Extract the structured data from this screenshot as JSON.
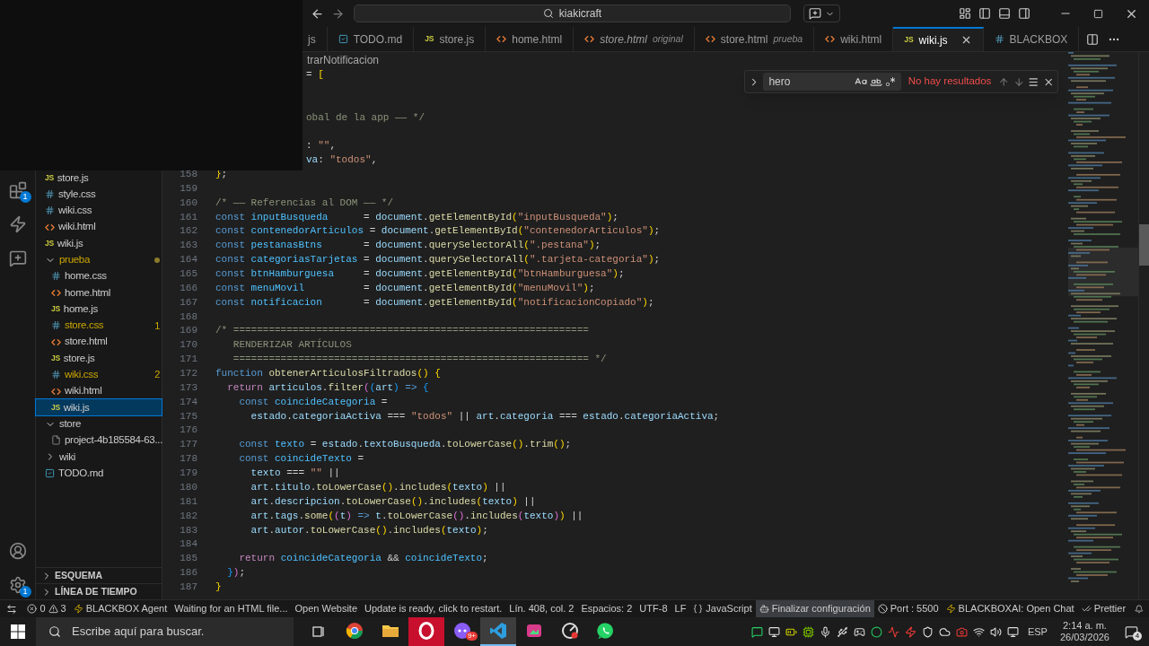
{
  "title_bar": {
    "search": "kiakicraft"
  },
  "activity_bar": {
    "extensions_badge": "1",
    "settings_badge": "1"
  },
  "tabs": [
    {
      "label": "js",
      "kind": "none",
      "italic": false,
      "selected": false
    },
    {
      "label": "TODO.md",
      "kind": "md",
      "italic": false,
      "selected": false
    },
    {
      "label": "store.js",
      "kind": "js",
      "icon_label": "JS",
      "italic": false,
      "selected": false
    },
    {
      "label": "home.html",
      "kind": "html",
      "italic": false,
      "selected": false
    },
    {
      "label": "store.html",
      "description": "original",
      "kind": "html",
      "italic": true,
      "selected": false
    },
    {
      "label": "store.html",
      "description": "prueba",
      "kind": "html",
      "italic": false,
      "selected": false
    },
    {
      "label": "wiki.html",
      "kind": "html",
      "italic": false,
      "selected": false
    },
    {
      "label": "wiki.js",
      "kind": "js",
      "icon_label": "JS",
      "italic": false,
      "selected": true
    },
    {
      "label": "BLACKBOX",
      "kind": "css",
      "italic": false,
      "selected": false
    }
  ],
  "explorer": {
    "items": [
      {
        "kind": "group",
        "children": [
          {
            "name": "store.js",
            "kind": "js",
            "icon_label": "JS",
            "selected": false,
            "warning": false
          },
          {
            "name": "style.css",
            "kind": "css",
            "selected": false,
            "warning": false
          },
          {
            "name": "wiki.css",
            "kind": "css",
            "selected": false,
            "warning": false
          },
          {
            "name": "wiki.html",
            "kind": "html",
            "selected": false,
            "warning": false
          },
          {
            "name": "wiki.js",
            "kind": "js",
            "icon_label": "JS",
            "selected": false,
            "warning": false
          }
        ]
      },
      {
        "name": "prueba",
        "kind": "folder",
        "expanded": true,
        "selected": false,
        "warning": true,
        "modified": true,
        "children": [
          {
            "name": "home.css",
            "kind": "css",
            "selected": false,
            "warning": false
          },
          {
            "name": "home.html",
            "kind": "html",
            "selected": false,
            "warning": false
          },
          {
            "name": "home.js",
            "kind": "js",
            "icon_label": "JS",
            "selected": false,
            "warning": false
          },
          {
            "name": "store.css",
            "kind": "css",
            "selected": false,
            "warning": true,
            "badge": "1"
          },
          {
            "name": "store.html",
            "kind": "html",
            "selected": false,
            "warning": false
          },
          {
            "name": "store.js",
            "kind": "js",
            "icon_label": "JS",
            "selected": false,
            "warning": false
          },
          {
            "name": "wiki.css",
            "kind": "css",
            "selected": false,
            "warning": true,
            "badge": "2"
          },
          {
            "name": "wiki.html",
            "kind": "html",
            "selected": false,
            "warning": false
          },
          {
            "name": "wiki.js",
            "kind": "js",
            "icon_label": "JS",
            "selected": true,
            "warning": false
          }
        ]
      },
      {
        "name": "store",
        "kind": "folder",
        "expanded": true,
        "selected": false,
        "warning": false,
        "modified": false,
        "children": [
          {
            "name": "project-4b185584-63...",
            "kind": "file",
            "selected": false,
            "warning": false
          }
        ]
      },
      {
        "name": "wiki",
        "kind": "folder",
        "expanded": false,
        "selected": false,
        "warning": false,
        "modified": false
      },
      {
        "name": "TODO.md",
        "kind": "md",
        "selected": false,
        "warning": false
      }
    ],
    "sections": [
      {
        "label": "ESQUEMA",
        "expanded": false
      },
      {
        "label": "LÍNEA DE TIEMPO",
        "expanded": false
      }
    ]
  },
  "editor": {
    "breadcrumb": "trarNotificacion",
    "find": {
      "value": "hero",
      "status": "No hay resultados"
    },
    "lines": [
      {
        "kind": "partial",
        "tokens": [
          {
            "kind": "plain",
            "text": "= "
          },
          {
            "kind": "bracket1",
            "text": "["
          }
        ]
      },
      {
        "kind": "partial"
      },
      {
        "kind": "partial"
      },
      {
        "kind": "partial",
        "tokens": [
          {
            "kind": "comment",
            "text": "obal de la app —— */"
          }
        ]
      },
      {
        "kind": "partial"
      },
      {
        "kind": "partial",
        "tokens": [
          {
            "kind": "plain",
            "text": ": "
          },
          {
            "kind": "string",
            "text": "\"\""
          },
          {
            "kind": "plain",
            "text": ","
          }
        ]
      },
      {
        "kind": "partial",
        "tokens": [
          {
            "kind": "variable",
            "text": "va"
          },
          {
            "kind": "plain",
            "text": ": "
          },
          {
            "kind": "string",
            "text": "\"todos\""
          },
          {
            "kind": "plain",
            "text": ","
          }
        ]
      },
      {
        "kind": "code",
        "number": "158",
        "tokens": [
          {
            "kind": "bracket1",
            "text": "}"
          },
          {
            "kind": "plain",
            "text": ";"
          }
        ]
      },
      {
        "kind": "code",
        "number": "159"
      },
      {
        "kind": "code",
        "number": "160",
        "tokens": [
          {
            "kind": "comment",
            "text": "/* —— Referencias al DOM —— */"
          }
        ]
      },
      {
        "kind": "code",
        "number": "161",
        "tokens": [
          {
            "kind": "keyword",
            "text": "const "
          },
          {
            "kind": "constant",
            "text": "inputBusqueda"
          },
          {
            "kind": "plain",
            "text": "      = "
          },
          {
            "kind": "variable",
            "text": "document"
          },
          {
            "kind": "plain",
            "text": "."
          },
          {
            "kind": "function",
            "text": "getElementById"
          },
          {
            "kind": "bracket1",
            "text": "("
          },
          {
            "kind": "string",
            "text": "\"inputBusqueda\""
          },
          {
            "kind": "bracket1",
            "text": ")"
          },
          {
            "kind": "plain",
            "text": ";"
          }
        ]
      },
      {
        "kind": "code",
        "number": "162",
        "tokens": [
          {
            "kind": "keyword",
            "text": "const "
          },
          {
            "kind": "constant",
            "text": "contenedorArticulos"
          },
          {
            "kind": "plain",
            "text": " = "
          },
          {
            "kind": "variable",
            "text": "document"
          },
          {
            "kind": "plain",
            "text": "."
          },
          {
            "kind": "function",
            "text": "getElementById"
          },
          {
            "kind": "bracket1",
            "text": "("
          },
          {
            "kind": "string",
            "text": "\"contenedorArticulos\""
          },
          {
            "kind": "bracket1",
            "text": ")"
          },
          {
            "kind": "plain",
            "text": ";"
          }
        ]
      },
      {
        "kind": "code",
        "number": "163",
        "tokens": [
          {
            "kind": "keyword",
            "text": "const "
          },
          {
            "kind": "constant",
            "text": "pestanasBtns"
          },
          {
            "kind": "plain",
            "text": "       = "
          },
          {
            "kind": "variable",
            "text": "document"
          },
          {
            "kind": "plain",
            "text": "."
          },
          {
            "kind": "function",
            "text": "querySelectorAll"
          },
          {
            "kind": "bracket1",
            "text": "("
          },
          {
            "kind": "string",
            "text": "\".pestana\""
          },
          {
            "kind": "bracket1",
            "text": ")"
          },
          {
            "kind": "plain",
            "text": ";"
          }
        ]
      },
      {
        "kind": "code",
        "number": "164",
        "tokens": [
          {
            "kind": "keyword",
            "text": "const "
          },
          {
            "kind": "constant",
            "text": "categoriasTarjetas"
          },
          {
            "kind": "plain",
            "text": " = "
          },
          {
            "kind": "variable",
            "text": "document"
          },
          {
            "kind": "plain",
            "text": "."
          },
          {
            "kind": "function",
            "text": "querySelectorAll"
          },
          {
            "kind": "bracket1",
            "text": "("
          },
          {
            "kind": "string",
            "text": "\".tarjeta-categoria\""
          },
          {
            "kind": "bracket1",
            "text": ")"
          },
          {
            "kind": "plain",
            "text": ";"
          }
        ]
      },
      {
        "kind": "code",
        "number": "165",
        "tokens": [
          {
            "kind": "keyword",
            "text": "const "
          },
          {
            "kind": "constant",
            "text": "btnHamburguesa"
          },
          {
            "kind": "plain",
            "text": "     = "
          },
          {
            "kind": "variable",
            "text": "document"
          },
          {
            "kind": "plain",
            "text": "."
          },
          {
            "kind": "function",
            "text": "getElementById"
          },
          {
            "kind": "bracket1",
            "text": "("
          },
          {
            "kind": "string",
            "text": "\"btnHamburguesa\""
          },
          {
            "kind": "bracket1",
            "text": ")"
          },
          {
            "kind": "plain",
            "text": ";"
          }
        ]
      },
      {
        "kind": "code",
        "number": "166",
        "tokens": [
          {
            "kind": "keyword",
            "text": "const "
          },
          {
            "kind": "constant",
            "text": "menuMovil"
          },
          {
            "kind": "plain",
            "text": "          = "
          },
          {
            "kind": "variable",
            "text": "document"
          },
          {
            "kind": "plain",
            "text": "."
          },
          {
            "kind": "function",
            "text": "getElementById"
          },
          {
            "kind": "bracket1",
            "text": "("
          },
          {
            "kind": "string",
            "text": "\"menuMovil\""
          },
          {
            "kind": "bracket1",
            "text": ")"
          },
          {
            "kind": "plain",
            "text": ";"
          }
        ]
      },
      {
        "kind": "code",
        "number": "167",
        "tokens": [
          {
            "kind": "keyword",
            "text": "const "
          },
          {
            "kind": "constant",
            "text": "notificacion"
          },
          {
            "kind": "plain",
            "text": "       = "
          },
          {
            "kind": "variable",
            "text": "document"
          },
          {
            "kind": "plain",
            "text": "."
          },
          {
            "kind": "function",
            "text": "getElementById"
          },
          {
            "kind": "bracket1",
            "text": "("
          },
          {
            "kind": "string",
            "text": "\"notificacionCopiado\""
          },
          {
            "kind": "bracket1",
            "text": ")"
          },
          {
            "kind": "plain",
            "text": ";"
          }
        ]
      },
      {
        "kind": "code",
        "number": "168"
      },
      {
        "kind": "code",
        "number": "169",
        "tokens": [
          {
            "kind": "comment",
            "text": "/* ============================================================"
          }
        ]
      },
      {
        "kind": "code",
        "number": "170",
        "tokens": [
          {
            "kind": "comment",
            "text": "   RENDERIZAR ARTÍCULOS"
          }
        ]
      },
      {
        "kind": "code",
        "number": "171",
        "tokens": [
          {
            "kind": "comment",
            "text": "   ============================================================ */"
          }
        ]
      },
      {
        "kind": "code",
        "number": "172",
        "tokens": [
          {
            "kind": "keyword",
            "text": "function "
          },
          {
            "kind": "function",
            "text": "obtenerArticulosFiltrados"
          },
          {
            "kind": "bracket1",
            "text": "() {"
          }
        ]
      },
      {
        "kind": "code",
        "number": "173",
        "tokens": [
          {
            "kind": "control",
            "text": "  return "
          },
          {
            "kind": "variable",
            "text": "articulos"
          },
          {
            "kind": "plain",
            "text": "."
          },
          {
            "kind": "function",
            "text": "filter"
          },
          {
            "kind": "bracket2",
            "text": "("
          },
          {
            "kind": "bracket3",
            "text": "("
          },
          {
            "kind": "variable",
            "text": "art"
          },
          {
            "kind": "bracket3",
            "text": ")"
          },
          {
            "kind": "keyword",
            "text": " => "
          },
          {
            "kind": "bracket3",
            "text": "{"
          }
        ]
      },
      {
        "kind": "code",
        "number": "174",
        "tokens": [
          {
            "kind": "keyword",
            "text": "    const "
          },
          {
            "kind": "constant",
            "text": "coincideCategoria"
          },
          {
            "kind": "plain",
            "text": " ="
          }
        ]
      },
      {
        "kind": "code",
        "number": "175",
        "tokens": [
          {
            "kind": "variable",
            "text": "      estado"
          },
          {
            "kind": "plain",
            "text": "."
          },
          {
            "kind": "variable",
            "text": "categoriaActiva"
          },
          {
            "kind": "plain",
            "text": " === "
          },
          {
            "kind": "string",
            "text": "\"todos\""
          },
          {
            "kind": "plain",
            "text": " || "
          },
          {
            "kind": "variable",
            "text": "art"
          },
          {
            "kind": "plain",
            "text": "."
          },
          {
            "kind": "variable",
            "text": "categoria"
          },
          {
            "kind": "plain",
            "text": " === "
          },
          {
            "kind": "variable",
            "text": "estado"
          },
          {
            "kind": "plain",
            "text": "."
          },
          {
            "kind": "variable",
            "text": "categoriaActiva"
          },
          {
            "kind": "plain",
            "text": ";"
          }
        ]
      },
      {
        "kind": "code",
        "number": "176"
      },
      {
        "kind": "code",
        "number": "177",
        "tokens": [
          {
            "kind": "keyword",
            "text": "    const "
          },
          {
            "kind": "constant",
            "text": "texto"
          },
          {
            "kind": "plain",
            "text": " = "
          },
          {
            "kind": "variable",
            "text": "estado"
          },
          {
            "kind": "plain",
            "text": "."
          },
          {
            "kind": "variable",
            "text": "textoBusqueda"
          },
          {
            "kind": "plain",
            "text": "."
          },
          {
            "kind": "function",
            "text": "toLowerCase"
          },
          {
            "kind": "bracket1",
            "text": "()"
          },
          {
            "kind": "plain",
            "text": "."
          },
          {
            "kind": "function",
            "text": "trim"
          },
          {
            "kind": "bracket1",
            "text": "()"
          },
          {
            "kind": "plain",
            "text": ";"
          }
        ]
      },
      {
        "kind": "code",
        "number": "178",
        "tokens": [
          {
            "kind": "keyword",
            "text": "    const "
          },
          {
            "kind": "constant",
            "text": "coincideTexto"
          },
          {
            "kind": "plain",
            "text": " ="
          }
        ]
      },
      {
        "kind": "code",
        "number": "179",
        "tokens": [
          {
            "kind": "variable",
            "text": "      texto"
          },
          {
            "kind": "plain",
            "text": " === "
          },
          {
            "kind": "string",
            "text": "\"\""
          },
          {
            "kind": "plain",
            "text": " ||"
          }
        ]
      },
      {
        "kind": "code",
        "number": "180",
        "tokens": [
          {
            "kind": "variable",
            "text": "      art"
          },
          {
            "kind": "plain",
            "text": "."
          },
          {
            "kind": "variable",
            "text": "titulo"
          },
          {
            "kind": "plain",
            "text": "."
          },
          {
            "kind": "function",
            "text": "toLowerCase"
          },
          {
            "kind": "bracket1",
            "text": "()"
          },
          {
            "kind": "plain",
            "text": "."
          },
          {
            "kind": "function",
            "text": "includes"
          },
          {
            "kind": "bracket1",
            "text": "("
          },
          {
            "kind": "variable",
            "text": "texto"
          },
          {
            "kind": "bracket1",
            "text": ")"
          },
          {
            "kind": "plain",
            "text": " ||"
          }
        ]
      },
      {
        "kind": "code",
        "number": "181",
        "tokens": [
          {
            "kind": "variable",
            "text": "      art"
          },
          {
            "kind": "plain",
            "text": "."
          },
          {
            "kind": "variable",
            "text": "descripcion"
          },
          {
            "kind": "plain",
            "text": "."
          },
          {
            "kind": "function",
            "text": "toLowerCase"
          },
          {
            "kind": "bracket1",
            "text": "()"
          },
          {
            "kind": "plain",
            "text": "."
          },
          {
            "kind": "function",
            "text": "includes"
          },
          {
            "kind": "bracket1",
            "text": "("
          },
          {
            "kind": "variable",
            "text": "texto"
          },
          {
            "kind": "bracket1",
            "text": ")"
          },
          {
            "kind": "plain",
            "text": " ||"
          }
        ]
      },
      {
        "kind": "code",
        "number": "182",
        "tokens": [
          {
            "kind": "variable",
            "text": "      art"
          },
          {
            "kind": "plain",
            "text": "."
          },
          {
            "kind": "variable",
            "text": "tags"
          },
          {
            "kind": "plain",
            "text": "."
          },
          {
            "kind": "function",
            "text": "some"
          },
          {
            "kind": "bracket1",
            "text": "("
          },
          {
            "kind": "bracket2",
            "text": "("
          },
          {
            "kind": "variable",
            "text": "t"
          },
          {
            "kind": "bracket2",
            "text": ")"
          },
          {
            "kind": "keyword",
            "text": " => "
          },
          {
            "kind": "variable",
            "text": "t"
          },
          {
            "kind": "plain",
            "text": "."
          },
          {
            "kind": "function",
            "text": "toLowerCase"
          },
          {
            "kind": "bracket2",
            "text": "()"
          },
          {
            "kind": "plain",
            "text": "."
          },
          {
            "kind": "function",
            "text": "includes"
          },
          {
            "kind": "bracket2",
            "text": "("
          },
          {
            "kind": "variable",
            "text": "texto"
          },
          {
            "kind": "bracket2",
            "text": ")"
          },
          {
            "kind": "bracket1",
            "text": ")"
          },
          {
            "kind": "plain",
            "text": " ||"
          }
        ]
      },
      {
        "kind": "code",
        "number": "183",
        "tokens": [
          {
            "kind": "variable",
            "text": "      art"
          },
          {
            "kind": "plain",
            "text": "."
          },
          {
            "kind": "variable",
            "text": "autor"
          },
          {
            "kind": "plain",
            "text": "."
          },
          {
            "kind": "function",
            "text": "toLowerCase"
          },
          {
            "kind": "bracket1",
            "text": "()"
          },
          {
            "kind": "plain",
            "text": "."
          },
          {
            "kind": "function",
            "text": "includes"
          },
          {
            "kind": "bracket1",
            "text": "("
          },
          {
            "kind": "variable",
            "text": "texto"
          },
          {
            "kind": "bracket1",
            "text": ")"
          },
          {
            "kind": "plain",
            "text": ";"
          }
        ]
      },
      {
        "kind": "code",
        "number": "184"
      },
      {
        "kind": "code",
        "number": "185",
        "tokens": [
          {
            "kind": "control",
            "text": "    return "
          },
          {
            "kind": "constant",
            "text": "coincideCategoria"
          },
          {
            "kind": "plain",
            "text": " && "
          },
          {
            "kind": "constant",
            "text": "coincideTexto"
          },
          {
            "kind": "plain",
            "text": ";"
          }
        ]
      },
      {
        "kind": "code",
        "number": "186",
        "tokens": [
          {
            "kind": "bracket3",
            "text": "  }"
          },
          {
            "kind": "bracket2",
            "text": ")"
          },
          {
            "kind": "plain",
            "text": ";"
          }
        ]
      },
      {
        "kind": "code",
        "number": "187",
        "tokens": [
          {
            "kind": "bracket1",
            "text": "}"
          }
        ]
      }
    ]
  },
  "status_bar": {
    "left": [
      {
        "kind": "problems",
        "errors": "0",
        "warnings": "3"
      },
      {
        "kind": "agent",
        "text": "BLACKBOX Agent"
      },
      {
        "kind": "plain",
        "text": "Waiting for an HTML file..."
      },
      {
        "kind": "plain",
        "text": "Open Website"
      },
      {
        "kind": "plain",
        "text": "Update is ready, click to restart."
      }
    ],
    "right": [
      {
        "kind": "plain",
        "text": "Lín. 408, col. 2",
        "highlighted": false
      },
      {
        "kind": "plain",
        "text": "Espacios: 2",
        "highlighted": false
      },
      {
        "kind": "plain",
        "text": "UTF-8",
        "highlighted": false
      },
      {
        "kind": "plain",
        "text": "LF",
        "highlighted": false
      },
      {
        "kind": "language",
        "text": "JavaScript",
        "highlighted": false
      },
      {
        "kind": "setup",
        "text": "Finalizar configuración",
        "highlighted": true
      },
      {
        "kind": "port",
        "text": "Port : 5500",
        "highlighted": false
      },
      {
        "kind": "agent",
        "text": "BLACKBOXAI: Open Chat",
        "highlighted": false
      },
      {
        "kind": "prettier",
        "text": "Prettier",
        "highlighted": false
      }
    ]
  },
  "taskbar": {
    "search_placeholder": "Escribe aquí para buscar.",
    "apps": [
      {
        "kind": "browser",
        "active": false
      },
      {
        "kind": "folder",
        "active": false
      },
      {
        "kind": "ring",
        "active": false
      },
      {
        "kind": "chat",
        "active": false,
        "badge": "9+"
      },
      {
        "kind": "editor",
        "active": true
      },
      {
        "kind": "gallery",
        "active": false
      },
      {
        "kind": "dial",
        "active": false
      },
      {
        "kind": "phone",
        "active": false
      }
    ],
    "language": "ESP",
    "time": "2:14 a. m.",
    "date": "26/03/2026",
    "notifications": "4"
  }
}
